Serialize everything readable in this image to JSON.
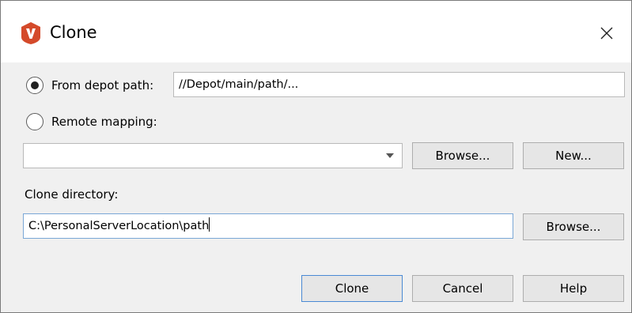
{
  "window": {
    "title": "Clone",
    "app_icon": "perforce-v-logo",
    "close_icon": "close-x-icon",
    "accent_color": "#d44a2a"
  },
  "depot": {
    "radio_label": "From depot path:",
    "selected": true,
    "value": "//Depot/main/path/..."
  },
  "remote": {
    "radio_label": "Remote mapping:",
    "selected": false,
    "combo_value": "",
    "browse_label": "Browse...",
    "new_label": "New..."
  },
  "clone_dir": {
    "label": "Clone directory:",
    "value": "C:\\PersonalServerLocation\\path",
    "browse_label": "Browse..."
  },
  "footer": {
    "clone_label": "Clone",
    "cancel_label": "Cancel",
    "help_label": "Help"
  }
}
